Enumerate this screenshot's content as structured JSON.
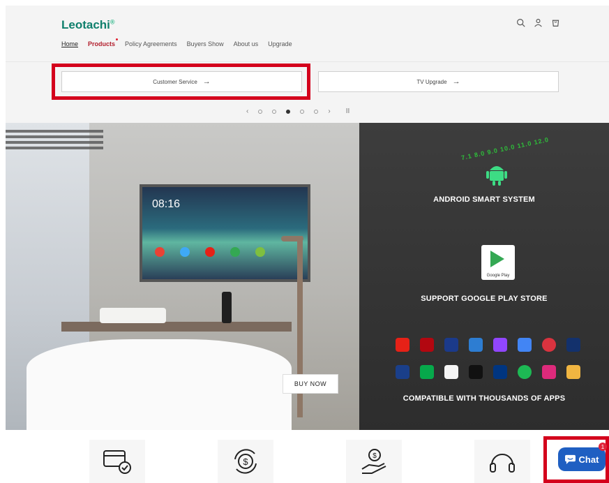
{
  "brand": {
    "name": "Leotachi",
    "mark": "®"
  },
  "nav": [
    {
      "label": "Home"
    },
    {
      "label": "Products"
    },
    {
      "label": "Policy Agreements"
    },
    {
      "label": "Buyers Show"
    },
    {
      "label": "About us"
    },
    {
      "label": "Upgrade"
    }
  ],
  "header_icons": [
    "search-icon",
    "user-icon",
    "cart-icon"
  ],
  "service_buttons": [
    {
      "label": "Customer Service"
    },
    {
      "label": "TV Upgrade"
    }
  ],
  "slider": {
    "total": 5,
    "active": 3
  },
  "tv": {
    "clock": "08:16"
  },
  "banner": {
    "buy_now": "BUY NOW",
    "android_versions": "7.1 8.0 9.0 10.0 11.0 12.0",
    "android_heading": "ANDROID SMART SYSTEM",
    "play_label": "Google Play",
    "play_heading": "SUPPORT  GOOGLE PLAY STORE",
    "apps_heading": "COMPATIBLE WITH THOUSANDS OF APPS"
  },
  "app_icons_row1": [
    {
      "name": "youtube-icon",
      "color": "#e62117"
    },
    {
      "name": "netflix-icon",
      "color": "#b20710"
    },
    {
      "name": "disney-icon",
      "color": "#1b3a8a"
    },
    {
      "name": "paramount-icon",
      "color": "#2d7dd2"
    },
    {
      "name": "twitch-icon",
      "color": "#9146ff"
    },
    {
      "name": "google-tv-icon",
      "color": "#4285f4"
    },
    {
      "name": "red-app-icon",
      "color": "#d9333f"
    },
    {
      "name": "fox-news-icon",
      "color": "#13316c"
    }
  ],
  "app_icons_row2": [
    {
      "name": "weather-channel-icon",
      "color": "#1a3f8a"
    },
    {
      "name": "uber-eats-icon",
      "color": "#06a94b"
    },
    {
      "name": "ebay-icon",
      "color": "#f5f5f5"
    },
    {
      "name": "stan-icon",
      "color": "#111111"
    },
    {
      "name": "booking-icon",
      "color": "#003580"
    },
    {
      "name": "spotify-icon",
      "color": "#1db954"
    },
    {
      "name": "instagram-icon",
      "color": "#dd2a7b"
    },
    {
      "name": "mail-icon",
      "color": "#f0b541"
    }
  ],
  "features": [
    "card-check-icon",
    "refund-icon",
    "money-hand-icon",
    "headset-icon"
  ],
  "chat": {
    "label": "Chat",
    "badge": "1"
  }
}
